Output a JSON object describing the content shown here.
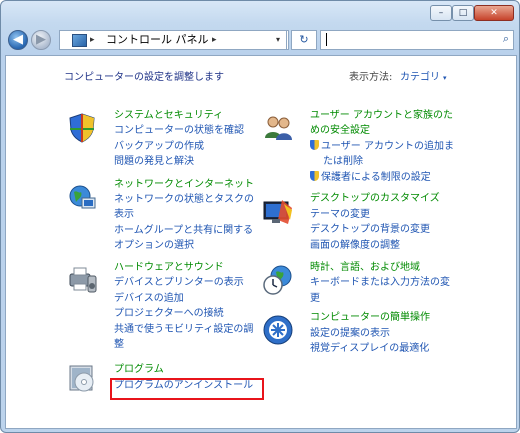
{
  "window": {
    "minimize": "–",
    "maximize": "□",
    "close": "✕"
  },
  "address_bar": {
    "root_label": "コントロール パネル",
    "search_placeholder": ""
  },
  "toolbar": {
    "back_arrow": "◀",
    "forward_arrow": "▶",
    "dropdown": "▾",
    "refresh": "↻",
    "search_icon": "⌕"
  },
  "header": {
    "title": "コンピューターの設定を調整します",
    "view_by_label": "表示方法:",
    "view_by_value": "カテゴリ"
  },
  "categories": [
    {
      "title": "システムとセキュリティ",
      "links": [
        "コンピューターの状態を確認",
        "バックアップの作成",
        "問題の発見と解決"
      ]
    },
    {
      "title": "ネットワークとインターネット",
      "links": [
        "ネットワークの状態とタスクの",
        "表示",
        "ホームグループと共有に関する",
        "オプションの選択"
      ]
    },
    {
      "title": "ハードウェアとサウンド",
      "links": [
        "デバイスとプリンターの表示",
        "デバイスの追加",
        "プロジェクターへの接続",
        "共通で使うモビリティ設定の調",
        "整"
      ]
    },
    {
      "title": "プログラム",
      "links": [
        "プログラムのアンインストール"
      ]
    },
    {
      "title": "ユーザー アカウントと家族のた",
      "title2": "めの安全設定",
      "links": [
        "ユーザー アカウントの追加ま",
        "たは削除",
        "保護者による制限の設定"
      ]
    },
    {
      "title": "デスクトップのカスタマイズ",
      "links": [
        "テーマの変更",
        "デスクトップの背景の変更",
        "画面の解像度の調整"
      ]
    },
    {
      "title": "時計、言語、および地域",
      "links": [
        "キーボードまたは入力方法の変",
        "更"
      ]
    },
    {
      "title": "コンピューターの簡単操作",
      "links": [
        "設定の提案の表示",
        "視覚ディスプレイの最適化"
      ]
    }
  ],
  "colors": {
    "category_title": "#008a00",
    "link": "#1f55b2",
    "highlight": "#e8141b",
    "heading": "#1e3287"
  }
}
